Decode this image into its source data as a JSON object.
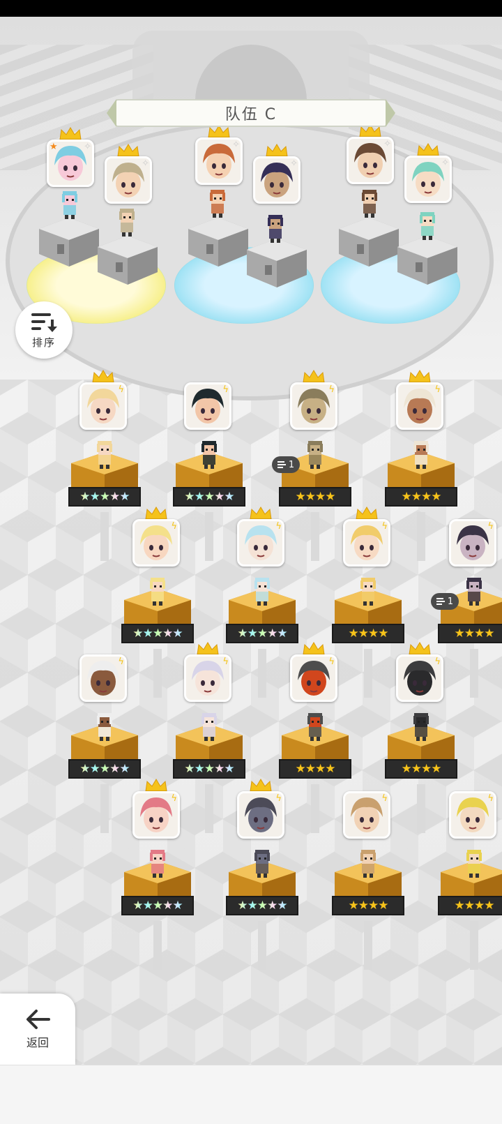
{
  "team": {
    "title": "队伍 C"
  },
  "sort_button": {
    "label": "排序",
    "icon": "sort-icon"
  },
  "back_button": {
    "label": "返回",
    "icon": "arrow-left-icon"
  },
  "team_slots": [
    {
      "crown": true,
      "leader_star": true,
      "skin": "#f7c9d8",
      "hair": "#7ecde2"
    },
    {
      "crown": true,
      "skin": "#f3d2b4",
      "hair": "#bfb08d"
    },
    {
      "crown": true,
      "skin": "#f5d1b2",
      "hair": "#c96a3a"
    },
    {
      "crown": true,
      "skin": "#caa37e",
      "hair": "#352f57"
    },
    {
      "crown": true,
      "skin": "#f0cfb1",
      "hair": "#6b4a35"
    },
    {
      "crown": true,
      "skin": "#f6dcc4",
      "hair": "#7fd3c0"
    }
  ],
  "roster": [
    {
      "stars": 5,
      "rainbow": true,
      "crown": true,
      "hair": "#f2d79b",
      "skin": "#f6d8c3"
    },
    {
      "stars": 5,
      "rainbow": true,
      "crown": false,
      "hair": "#1f2a2e",
      "skin": "#f2c6a8"
    },
    {
      "stars": 4,
      "rainbow": false,
      "crown": true,
      "hair": "#8a7d5c",
      "skin": "#c7b085",
      "team": "1"
    },
    {
      "stars": 4,
      "rainbow": false,
      "crown": true,
      "hair": "#eee5d4",
      "skin": "#b87a55"
    },
    {
      "stars": 5,
      "rainbow": true,
      "crown": true,
      "hair": "#f4e08a",
      "skin": "#f8d7c0"
    },
    {
      "stars": 5,
      "rainbow": true,
      "crown": true,
      "hair": "#b8e2ef",
      "skin": "#f5e2d5"
    },
    {
      "stars": 4,
      "rainbow": false,
      "crown": true,
      "hair": "#f1cc6b",
      "skin": "#f7dac3"
    },
    {
      "stars": 4,
      "rainbow": false,
      "crown": false,
      "hair": "#3b3346",
      "skin": "#c9b3c2",
      "team": "1"
    },
    {
      "stars": 5,
      "rainbow": true,
      "crown": false,
      "hair": "#eeeeee",
      "skin": "#8a5a3d"
    },
    {
      "stars": 5,
      "rainbow": true,
      "crown": true,
      "hair": "#d8d4e8",
      "skin": "#f6e4da"
    },
    {
      "stars": 4,
      "rainbow": false,
      "crown": true,
      "hair": "#4d4d4d",
      "skin": "#d1461d"
    },
    {
      "stars": 4,
      "rainbow": false,
      "crown": true,
      "hair": "#3c3c3e",
      "skin": "#2a2a2c"
    },
    {
      "stars": 5,
      "rainbow": true,
      "crown": true,
      "hair": "#e37a86",
      "skin": "#f7d3c5"
    },
    {
      "stars": 5,
      "rainbow": true,
      "crown": true,
      "hair": "#4c4b58",
      "skin": "#6d6e82"
    },
    {
      "stars": 4,
      "rainbow": false,
      "crown": false,
      "hair": "#c9a06e",
      "skin": "#f1d2b5"
    },
    {
      "stars": 4,
      "rainbow": false,
      "crown": false,
      "hair": "#e9d24f",
      "skin": "#f3dac0"
    }
  ],
  "star_glyph": "★"
}
